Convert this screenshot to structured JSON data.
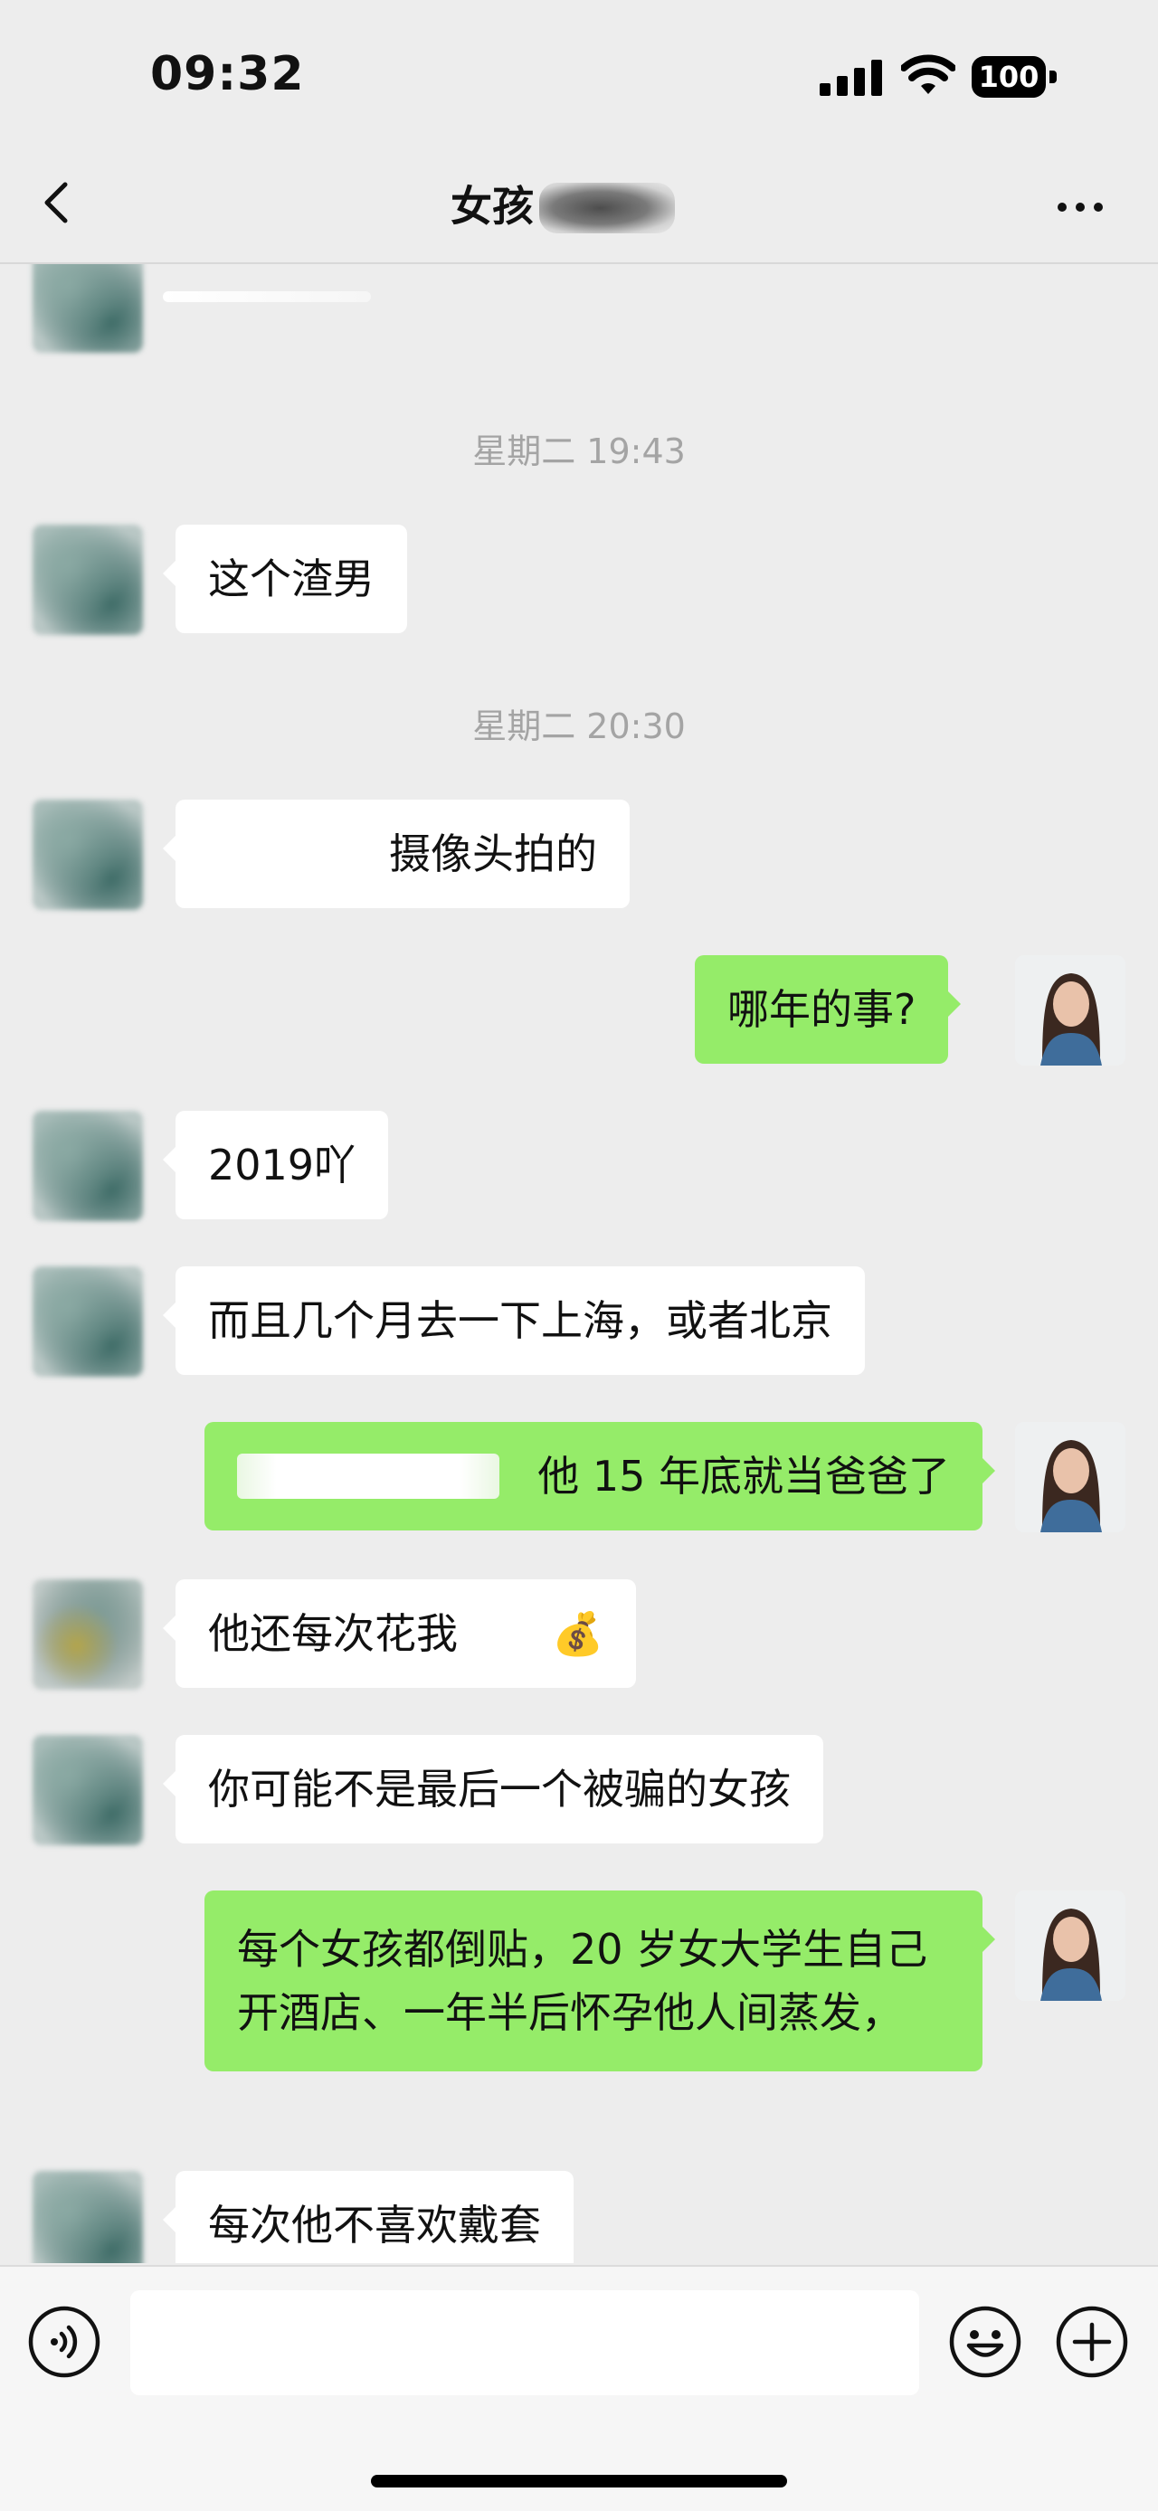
{
  "status": {
    "time": "09:32",
    "battery": "100"
  },
  "nav": {
    "title": "女孩"
  },
  "messages": {
    "ts1": "星期二 19:43",
    "m1": "这个渣男",
    "ts2": "星期二 20:30",
    "m2": "摄像头拍的",
    "m3": "哪年的事?",
    "m4": "2019吖",
    "m5": "而且几个月去一下上海，或者北京",
    "m6": "他 15 年底就当爸爸了",
    "m7": "他还每次花我",
    "m7_emoji": "💰",
    "m8": "你可能不是最后一个被骗的女孩",
    "m9": "每个女孩都倒贴，20 岁女大学生自己开酒店、一年半后怀孕他人间蒸发，",
    "m10": "每次他不喜欢戴套"
  },
  "icons": {
    "back": "chevron-left-icon",
    "more": "more-dots-icon",
    "voice": "voice-icon",
    "emoji": "emoji-icon",
    "plus": "plus-icon"
  },
  "colors": {
    "background": "#ededed",
    "self_bubble": "#95ec69",
    "other_bubble": "#ffffff",
    "timestamp": "#a4a4a4"
  }
}
